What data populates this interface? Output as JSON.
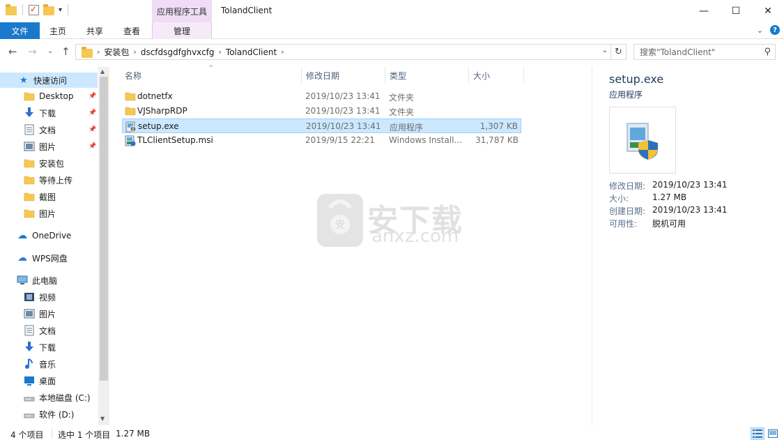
{
  "window": {
    "title": "TolandClient",
    "context_tab": "应用程序工具",
    "controls": [
      "minimize",
      "maximize",
      "close"
    ]
  },
  "ribbon": {
    "tabs": [
      "文件",
      "主页",
      "共享",
      "查看"
    ],
    "context_tab_label": "管理"
  },
  "address": {
    "crumbs": [
      "安装包",
      "dscfdsgdfghvxcfg",
      "TolandClient"
    ],
    "search_placeholder": "搜索\"TolandClient\""
  },
  "nav": {
    "quick_access": "快速访问",
    "quick_items": [
      {
        "label": "Desktop",
        "icon": "folder-icon",
        "pinned": true
      },
      {
        "label": "下载",
        "icon": "download-icon",
        "pinned": true
      },
      {
        "label": "文档",
        "icon": "document-icon",
        "pinned": true
      },
      {
        "label": "图片",
        "icon": "picture-icon",
        "pinned": true
      },
      {
        "label": "安装包",
        "icon": "folder-icon",
        "pinned": false
      },
      {
        "label": "等待上传",
        "icon": "folder-icon",
        "pinned": false
      },
      {
        "label": "截图",
        "icon": "folder-icon",
        "pinned": false
      },
      {
        "label": "图片",
        "icon": "folder-icon",
        "pinned": false
      }
    ],
    "onedrive": "OneDrive",
    "wps": "WPS网盘",
    "this_pc": "此电脑",
    "pc_items": [
      {
        "label": "视频",
        "icon": "video-icon"
      },
      {
        "label": "图片",
        "icon": "picture-icon"
      },
      {
        "label": "文档",
        "icon": "document-icon"
      },
      {
        "label": "下载",
        "icon": "download-icon"
      },
      {
        "label": "音乐",
        "icon": "music-icon"
      },
      {
        "label": "桌面",
        "icon": "desktop-icon"
      },
      {
        "label": "本地磁盘 (C:)",
        "icon": "drive-icon"
      },
      {
        "label": "软件 (D:)",
        "icon": "drive-icon"
      }
    ]
  },
  "columns": {
    "name": "名称",
    "date": "修改日期",
    "type": "类型",
    "size": "大小"
  },
  "files": [
    {
      "name": "dotnetfx",
      "date": "2019/10/23 13:41",
      "type": "文件夹",
      "size": "",
      "icon": "folder-icon",
      "selected": false
    },
    {
      "name": "VJSharpRDP",
      "date": "2019/10/23 13:41",
      "type": "文件夹",
      "size": "",
      "icon": "folder-icon",
      "selected": false
    },
    {
      "name": "setup.exe",
      "date": "2019/10/23 13:41",
      "type": "应用程序",
      "size": "1,307 KB",
      "icon": "exe-icon",
      "selected": true
    },
    {
      "name": "TLClientSetup.msi",
      "date": "2019/9/15 22:21",
      "type": "Windows Install...",
      "size": "31,787 KB",
      "icon": "msi-icon",
      "selected": false
    }
  ],
  "details": {
    "title": "setup.exe",
    "subtitle": "应用程序",
    "props": [
      {
        "label": "修改日期:",
        "value": "2019/10/23 13:41"
      },
      {
        "label": "大小:",
        "value": "1.27 MB"
      },
      {
        "label": "创建日期:",
        "value": "2019/10/23 13:41"
      },
      {
        "label": "可用性:",
        "value": "脱机可用"
      }
    ]
  },
  "watermark": {
    "cn": "安下载",
    "en": "anxz.com"
  },
  "status": {
    "count": "4 个项目",
    "selection": "选中 1 个项目",
    "size": "1.27 MB"
  },
  "colors": {
    "accent": "#1979ca",
    "selection": "#cce8ff",
    "context_tab": "#f0dcf4"
  }
}
